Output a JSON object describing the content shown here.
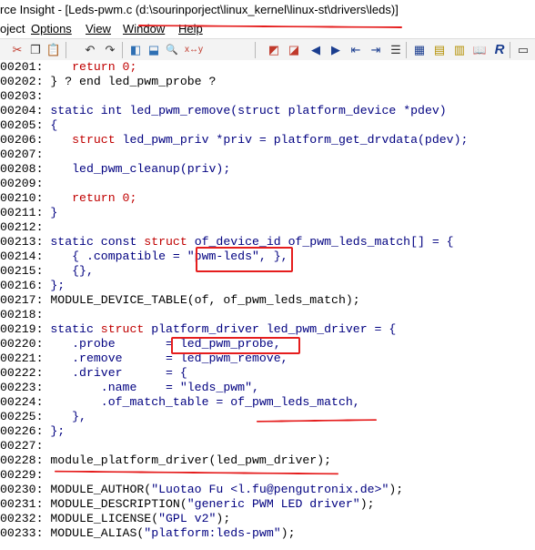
{
  "window": {
    "title_prefix": "rce Insight - [Leds-pwm.c (",
    "title_path": "d:\\sourinporject\\linux_kernel\\linux-st\\drivers\\leds",
    "title_suffix": ")]"
  },
  "menu": {
    "items": [
      {
        "label": "oject"
      },
      {
        "label": "Options"
      },
      {
        "label": "View"
      },
      {
        "label": "Window"
      },
      {
        "label": "Help"
      }
    ]
  },
  "toolbar": {
    "buttons": [
      {
        "icon": "cut-icon",
        "glyph": "✂"
      },
      {
        "icon": "copy-icon",
        "glyph": "❐"
      },
      {
        "icon": "paste-icon",
        "glyph": "📋"
      },
      {
        "icon": "undo-icon",
        "glyph": "↶"
      },
      {
        "icon": "redo-icon",
        "glyph": "↷"
      },
      {
        "icon": "bookmark-icon",
        "glyph": "◧"
      },
      {
        "icon": "replace-icon",
        "glyph": "⬓"
      },
      {
        "icon": "search-icon",
        "glyph": "🔍"
      },
      {
        "icon": "swap-icon",
        "glyph": "x↔y"
      },
      {
        "icon": "prev-bookmark-icon",
        "glyph": "◩"
      },
      {
        "icon": "next-bookmark-icon",
        "glyph": "◪"
      },
      {
        "icon": "back-icon",
        "glyph": "◀"
      },
      {
        "icon": "forward-icon",
        "glyph": "▶"
      },
      {
        "icon": "jump-prev-icon",
        "glyph": "⇤"
      },
      {
        "icon": "jump-next-icon",
        "glyph": "⇥"
      },
      {
        "icon": "list-icon",
        "glyph": "☰"
      },
      {
        "icon": "symbol-window-icon",
        "glyph": "▦"
      },
      {
        "icon": "relation-window-icon",
        "glyph": "▤"
      },
      {
        "icon": "context-window-icon",
        "glyph": "▥"
      },
      {
        "icon": "book-icon",
        "glyph": "📖"
      },
      {
        "icon": "r-logo-icon",
        "glyph": "R"
      },
      {
        "icon": "panel-icon",
        "glyph": "▭"
      }
    ]
  },
  "code": {
    "lines": [
      {
        "num": "00201:",
        "segs": [
          {
            "t": "    ",
            "c": ""
          },
          {
            "t": "return 0;",
            "c": "red"
          }
        ]
      },
      {
        "num": "00202:",
        "segs": [
          {
            "t": " } ? end led_pwm_probe ?",
            "c": ""
          }
        ]
      },
      {
        "num": "00203:",
        "segs": []
      },
      {
        "num": "00204:",
        "segs": [
          {
            "t": " static int ",
            "c": "kw"
          },
          {
            "t": "led_pwm_remove(",
            "c": "fn"
          },
          {
            "t": "struct ",
            "c": "kw"
          },
          {
            "t": "platform_device *pdev)",
            "c": "fn"
          }
        ]
      },
      {
        "num": "00205:",
        "segs": [
          {
            "t": " {",
            "c": "kw"
          }
        ]
      },
      {
        "num": "00206:",
        "segs": [
          {
            "t": "    ",
            "c": ""
          },
          {
            "t": "struct ",
            "c": "red"
          },
          {
            "t": "led_pwm_priv *priv = platform_get_drvdata(pdev);",
            "c": "kw"
          }
        ]
      },
      {
        "num": "00207:",
        "segs": []
      },
      {
        "num": "00208:",
        "segs": [
          {
            "t": "    led_pwm_cleanup(priv);",
            "c": "kw"
          }
        ]
      },
      {
        "num": "00209:",
        "segs": []
      },
      {
        "num": "00210:",
        "segs": [
          {
            "t": "    ",
            "c": ""
          },
          {
            "t": "return 0;",
            "c": "red"
          }
        ]
      },
      {
        "num": "00211:",
        "segs": [
          {
            "t": " }",
            "c": "kw"
          }
        ]
      },
      {
        "num": "00212:",
        "segs": []
      },
      {
        "num": "00213:",
        "segs": [
          {
            "t": " static const ",
            "c": "kw"
          },
          {
            "t": "struct ",
            "c": "red"
          },
          {
            "t": "of_device_id of_pwm_leds_match[] = {",
            "c": "kw"
          }
        ]
      },
      {
        "num": "00214:",
        "segs": [
          {
            "t": "    { .compatible = ",
            "c": "kw"
          },
          {
            "t": "\"pwm-leds\"",
            "c": "str"
          },
          {
            "t": ", },",
            "c": "kw"
          }
        ]
      },
      {
        "num": "00215:",
        "segs": [
          {
            "t": "    {},",
            "c": "kw"
          }
        ]
      },
      {
        "num": "00216:",
        "segs": [
          {
            "t": " };",
            "c": "kw"
          }
        ]
      },
      {
        "num": "00217:",
        "segs": [
          {
            "t": " MODULE_DEVICE_TABLE(of, of_pwm_leds_match);",
            "c": ""
          }
        ]
      },
      {
        "num": "00218:",
        "segs": []
      },
      {
        "num": "00219:",
        "segs": [
          {
            "t": " static ",
            "c": "kw"
          },
          {
            "t": "struct ",
            "c": "red"
          },
          {
            "t": "platform_driver led_pwm_driver = {",
            "c": "kw"
          }
        ]
      },
      {
        "num": "00220:",
        "segs": [
          {
            "t": "    .probe       = led_pwm_probe,",
            "c": "kw"
          }
        ]
      },
      {
        "num": "00221:",
        "segs": [
          {
            "t": "    .remove      = led_pwm_remove,",
            "c": "kw"
          }
        ]
      },
      {
        "num": "00222:",
        "segs": [
          {
            "t": "    .driver      = {",
            "c": "kw"
          }
        ]
      },
      {
        "num": "00223:",
        "segs": [
          {
            "t": "        .name    = ",
            "c": "kw"
          },
          {
            "t": "\"leds_pwm\"",
            "c": "str"
          },
          {
            "t": ",",
            "c": "kw"
          }
        ]
      },
      {
        "num": "00224:",
        "segs": [
          {
            "t": "        .of_match_table = of_pwm_leds_match,",
            "c": "kw"
          }
        ]
      },
      {
        "num": "00225:",
        "segs": [
          {
            "t": "    },",
            "c": "kw"
          }
        ]
      },
      {
        "num": "00226:",
        "segs": [
          {
            "t": " };",
            "c": "kw"
          }
        ]
      },
      {
        "num": "00227:",
        "segs": []
      },
      {
        "num": "00228:",
        "segs": [
          {
            "t": " module_platform_driver(led_pwm_driver);",
            "c": ""
          }
        ]
      },
      {
        "num": "00229:",
        "segs": []
      },
      {
        "num": "00230:",
        "segs": [
          {
            "t": " MODULE_AUTHOR(",
            "c": ""
          },
          {
            "t": "\"Luotao Fu <l.fu@pengutronix.de>\"",
            "c": "str"
          },
          {
            "t": ");",
            "c": ""
          }
        ]
      },
      {
        "num": "00231:",
        "segs": [
          {
            "t": " MODULE_DESCRIPTION(",
            "c": ""
          },
          {
            "t": "\"generic PWM LED driver\"",
            "c": "str"
          },
          {
            "t": ");",
            "c": ""
          }
        ]
      },
      {
        "num": "00232:",
        "segs": [
          {
            "t": " MODULE_LICENSE(",
            "c": ""
          },
          {
            "t": "\"GPL v2\"",
            "c": "str"
          },
          {
            "t": ");",
            "c": ""
          }
        ]
      },
      {
        "num": "00233:",
        "segs": [
          {
            "t": " MODULE_ALIAS(",
            "c": ""
          },
          {
            "t": "\"platform:leds-pwm\"",
            "c": "str"
          },
          {
            "t": ");",
            "c": ""
          }
        ]
      }
    ]
  },
  "colors": {
    "keyword": "#000080",
    "red_keyword": "#c00000",
    "annotation": "#e51d1d"
  }
}
